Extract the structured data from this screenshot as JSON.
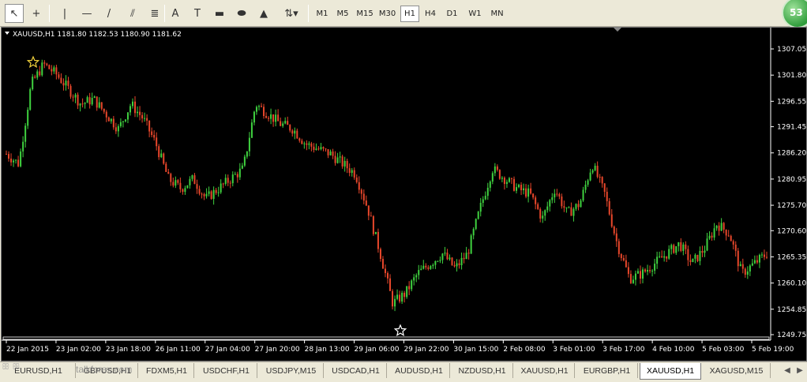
{
  "toolbar": {
    "tools": [
      {
        "name": "cursor-tool",
        "glyph": "↖"
      },
      {
        "name": "crosshair-tool",
        "glyph": "+"
      },
      {
        "name": "vertical-line-tool",
        "glyph": "|"
      },
      {
        "name": "horizontal-line-tool",
        "glyph": "—"
      },
      {
        "name": "trendline-tool",
        "glyph": "/"
      },
      {
        "name": "equidistant-channel-tool",
        "glyph": "⫽"
      },
      {
        "name": "fibonacci-tool",
        "glyph": "≣"
      },
      {
        "name": "text-tool",
        "glyph": "A"
      },
      {
        "name": "text-label-tool",
        "glyph": "T"
      },
      {
        "name": "rectangle-tool",
        "glyph": "▬"
      },
      {
        "name": "ellipse-tool",
        "glyph": "⬬"
      },
      {
        "name": "triangle-tool",
        "glyph": "▲"
      },
      {
        "name": "arrows-tool",
        "glyph": "⇅▾"
      }
    ],
    "timeframes": [
      "M1",
      "M5",
      "M15",
      "M30",
      "H1",
      "H4",
      "D1",
      "W1",
      "MN"
    ],
    "active_timeframe": "H1",
    "badge_value": "53"
  },
  "chart": {
    "header": "XAUUSD,H1  1181.80 1182.53 1180.90 1181.62",
    "price_labels": [
      "1307.05",
      "1301.80",
      "1296.55",
      "1291.45",
      "1286.20",
      "1280.95",
      "1275.70",
      "1270.60",
      "1265.35",
      "1260.10",
      "1254.85",
      "1249.75"
    ],
    "time_labels": [
      "22 Jan 2015",
      "23 Jan 02:00",
      "23 Jan 18:00",
      "26 Jan 11:00",
      "27 Jan 04:00",
      "27 Jan 20:00",
      "28 Jan 13:00",
      "29 Jan 06:00",
      "29 Jan 22:00",
      "30 Jan 15:00",
      "2 Feb 08:00",
      "3 Feb 01:00",
      "3 Feb 17:00",
      "4 Feb 10:00",
      "5 Feb 03:00",
      "5 Feb 19:00"
    ],
    "colors": {
      "bull": "#3fd13f",
      "bear": "#e8472b",
      "background": "#000000",
      "axis_text": "#ffffff",
      "star_high": "#f2d23c",
      "star_low": "#ffffff"
    }
  },
  "chart_data": {
    "type": "candlestick",
    "symbol": "XAUUSD",
    "timeframe": "H1",
    "ylim": [
      1249.75,
      1307.05
    ],
    "x_range": [
      "22 Jan 2015",
      "5 Feb 19:00"
    ],
    "approx_close_path": [
      1286,
      1284,
      1300,
      1304,
      1302,
      1299,
      1296,
      1297,
      1294,
      1291,
      1296,
      1293,
      1288,
      1281,
      1279,
      1281,
      1277,
      1279,
      1281,
      1283,
      1296,
      1294,
      1292,
      1291,
      1288,
      1287,
      1286,
      1284,
      1282,
      1275,
      1266,
      1256,
      1258,
      1262,
      1264,
      1266,
      1263,
      1266,
      1275,
      1283,
      1281,
      1279,
      1278,
      1273,
      1279,
      1274,
      1276,
      1284,
      1278,
      1268,
      1261,
      1262,
      1264,
      1266,
      1268,
      1264,
      1267,
      1272,
      1270,
      1262,
      1264,
      1266
    ],
    "marked_high": 1305.5,
    "marked_low": 1250.5
  },
  "tabs": {
    "items": [
      "EURUSD,H1",
      "GBPUSD,H1",
      "FDXM5,H1",
      "USDCHF,H1",
      "USDJPY,M15",
      "USDCAD,H1",
      "AUDUSD,H1",
      "NZDUSD,H1",
      "XAUUSD,H1",
      "EURGBP,H1",
      "XAUUSD,H1",
      "XAGUSD,M15"
    ],
    "active_index": 10,
    "watermark": "talkforex.com"
  }
}
